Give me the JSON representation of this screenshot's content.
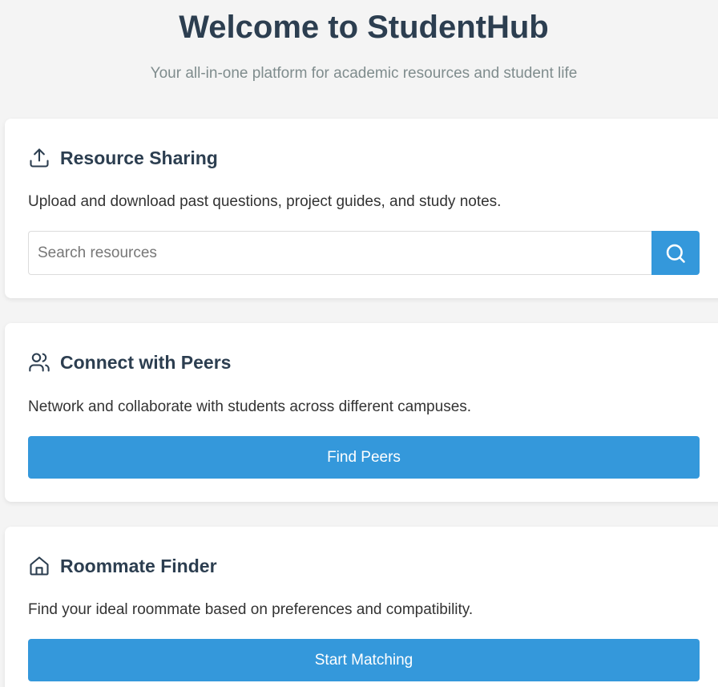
{
  "header": {
    "title": "Welcome to StudentHub",
    "subtitle": "Your all-in-one platform for academic resources and student life"
  },
  "cards": [
    {
      "icon": "upload-icon",
      "title": "Resource Sharing",
      "description": "Upload and download past questions, project guides, and study notes.",
      "search": {
        "placeholder": "Search resources",
        "value": "",
        "button_icon": "search-icon"
      }
    },
    {
      "icon": "users-icon",
      "title": "Connect with Peers",
      "description": "Network and collaborate with students across different campuses.",
      "button_label": "Find Peers"
    },
    {
      "icon": "home-icon",
      "title": "Roommate Finder",
      "description": "Find your ideal roommate based on preferences and compatibility.",
      "button_label": "Start Matching"
    }
  ],
  "colors": {
    "accent": "#3498db",
    "heading": "#2c3e50",
    "subtitle": "#7f8c8d",
    "background": "#f4f4f4",
    "card": "#ffffff"
  }
}
